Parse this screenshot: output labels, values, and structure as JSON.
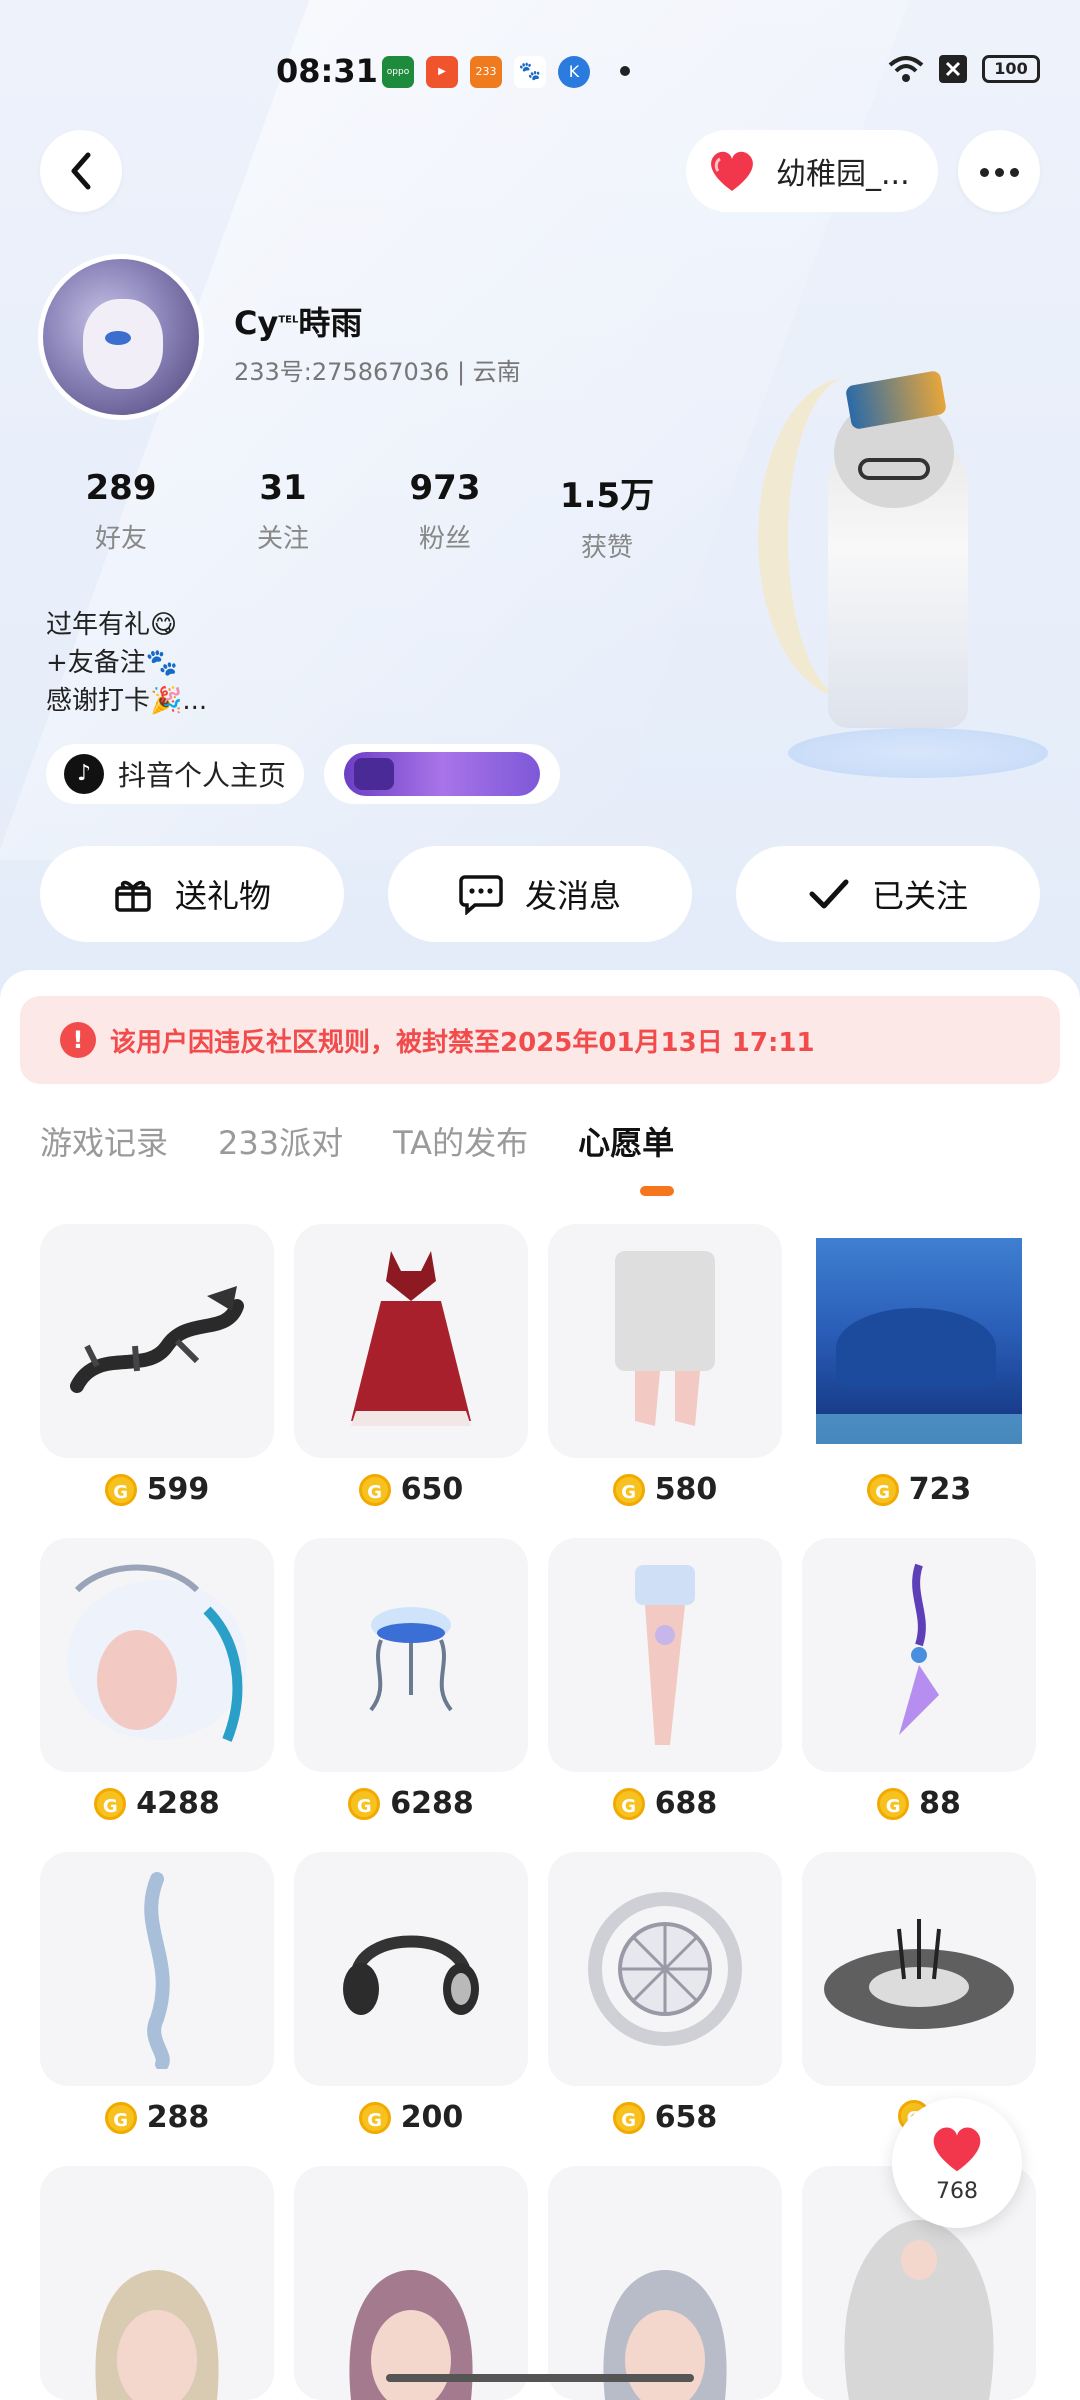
{
  "status_bar": {
    "time": "08:31",
    "battery": "100",
    "app_icons": [
      {
        "name": "oppo",
        "color": "#1e8a3c",
        "text": "oppo"
      },
      {
        "name": "video",
        "color": "#f0542d",
        "text": "▶"
      },
      {
        "name": "233",
        "color": "#f07a1e",
        "text": "233"
      },
      {
        "name": "baidu",
        "color": "#3f6bd8",
        "text": "🐾"
      },
      {
        "name": "k-app",
        "color": "#2b7bde",
        "text": "K"
      }
    ]
  },
  "header": {
    "group_name": "幼稚园_..."
  },
  "profile": {
    "nickname": "Cy",
    "nickname_sup": "TEL",
    "nickname_tail": "時雨",
    "uid_line": "233号:275867036 | 云南",
    "stats": [
      {
        "value": "289",
        "label": "好友"
      },
      {
        "value": "31",
        "label": "关注"
      },
      {
        "value": "973",
        "label": "粉丝"
      },
      {
        "value": "1.5万",
        "label": "获赞"
      }
    ],
    "bio": [
      "过年有礼😋",
      "+友备注🐾",
      "感谢打卡🎉..."
    ],
    "tiktok_label": "抖音个人主页"
  },
  "actions": {
    "gift": "送礼物",
    "message": "发消息",
    "follow": "已关注"
  },
  "ban_notice": "该用户因违反社区规则，被封禁至2025年01月13日 17:11",
  "tabs": [
    "游戏记录",
    "233派对",
    "TA的发布",
    "心愿单"
  ],
  "active_tab": 3,
  "wishlist": [
    {
      "price": "599",
      "thumb": "dragon-icon"
    },
    {
      "price": "650",
      "thumb": "red-hood-dress-icon"
    },
    {
      "price": "580",
      "thumb": "stockings-icon"
    },
    {
      "price": "723",
      "thumb": "landscape-icon"
    },
    {
      "price": "4288",
      "thumb": "white-hair-icon"
    },
    {
      "price": "6288",
      "thumb": "jellyfish-icon"
    },
    {
      "price": "688",
      "thumb": "leg-wear-icon"
    },
    {
      "price": "88",
      "thumb": "earring-icon"
    },
    {
      "price": "288",
      "thumb": "hair-clip-icon"
    },
    {
      "price": "200",
      "thumb": "headphones-icon"
    },
    {
      "price": "658",
      "thumb": "magic-circle-icon"
    },
    {
      "price": "",
      "thumb": "dark-circle-icon"
    },
    {
      "price": "",
      "thumb": "hair-blonde-icon"
    },
    {
      "price": "",
      "thumb": "hair-pink-icon"
    },
    {
      "price": "",
      "thumb": "hair-silver-icon"
    },
    {
      "price": "",
      "thumb": "hair-curly-icon"
    }
  ],
  "likes_count": "768",
  "colors": {
    "accent": "#f6761e",
    "ban_text": "#f24b4b",
    "ban_bg": "#fde8e8",
    "coin": "#f7c21f",
    "heart": "#f2364b"
  }
}
